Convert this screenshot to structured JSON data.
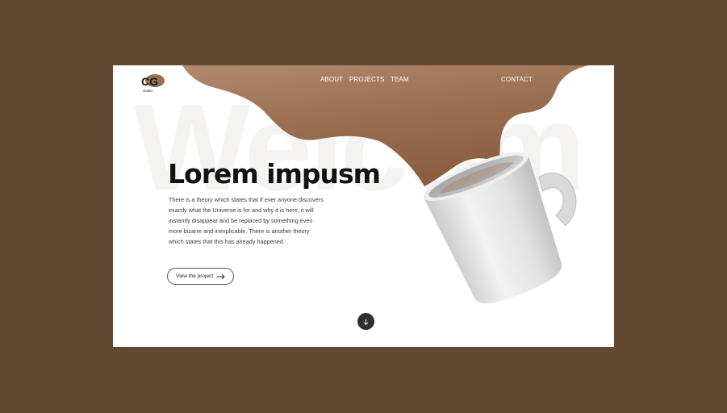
{
  "brand": {
    "logo_text": "CG",
    "logo_subtext": "studio",
    "colors": {
      "coffee": "#9b6f52",
      "background": "#634832"
    }
  },
  "nav": {
    "links": [
      "ABOUT",
      "PROJECTS",
      "TEAM"
    ],
    "contact": "CONTACT"
  },
  "hero": {
    "watermark": "Welcom",
    "title": "Lorem impusm",
    "body": "There is a theory which states that if ever anyone discovers exactly what the Universe is for and why it is here, it will instantly disappear and be replaced by something even more bizarre and inexplicable. There is another theory which states that this has already happened.",
    "cta_label": "View the project",
    "cta_icon": "arrow-right-icon",
    "scroll_icon": "arrow-down-icon"
  }
}
